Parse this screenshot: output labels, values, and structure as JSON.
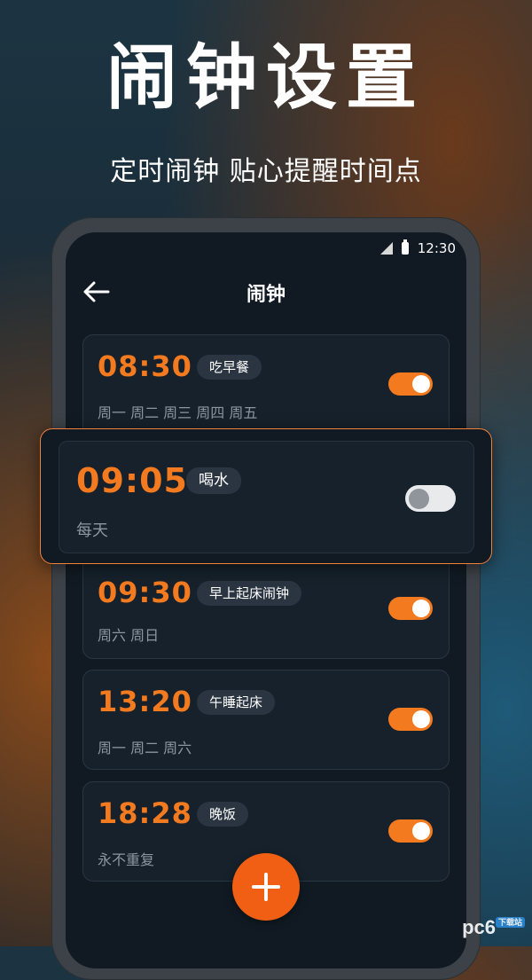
{
  "promo": {
    "title": "闹钟设置",
    "subtitle": "定时闹钟 贴心提醒时间点"
  },
  "status_bar": {
    "time": "12:30"
  },
  "nav": {
    "title": "闹钟",
    "back_icon": "arrow-left-icon"
  },
  "alarms": [
    {
      "time": "08:30",
      "tag": "吃早餐",
      "days": "周一 周二 周三 周四 周五",
      "enabled": true
    },
    {
      "time": "09:05",
      "tag": "喝水",
      "days": "每天",
      "enabled": false,
      "highlighted": true
    },
    {
      "time": "09:30",
      "tag": "早上起床闹钟",
      "days": "周六 周日",
      "enabled": true
    },
    {
      "time": "13:20",
      "tag": "午睡起床",
      "days": "周一 周二 周六",
      "enabled": true
    },
    {
      "time": "18:28",
      "tag": "晚饭",
      "days": "永不重复",
      "enabled": true
    }
  ],
  "add_button": {
    "icon": "plus-icon"
  },
  "watermark": {
    "text": "pc6",
    "badge": "下载站"
  },
  "colors": {
    "accent": "#f47a1f",
    "card": "#16212b",
    "screen": "#111a23"
  }
}
